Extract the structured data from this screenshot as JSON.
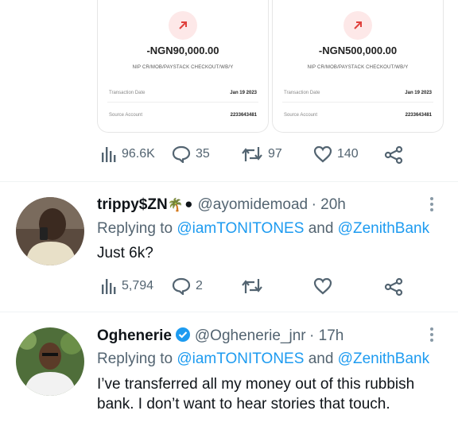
{
  "receipts": [
    {
      "amount": "-NGN90,000.00",
      "ref": "NIP CR/MOB/PAYSTACK CHECKOUT/WB/Y",
      "date_label": "Transaction Date",
      "date_value": "Jan 19 2023",
      "account_label": "Source Account",
      "account_value": "2233643481"
    },
    {
      "amount": "-NGN500,000.00",
      "ref": "NIP CR/MOB/PAYSTACK CHECKOUT/WB/Y",
      "date_label": "Transaction Date",
      "date_value": "Jan 19 2023",
      "account_label": "Source Account",
      "account_value": "2233643481"
    }
  ],
  "tweet1_actions": {
    "views": "96.6K",
    "replies": "35",
    "retweets": "97",
    "likes": "140"
  },
  "tweet2": {
    "name": "trippy$ZN",
    "emoji": "🌴⚫",
    "handle": "@ayomidemoad",
    "time": "· 20h",
    "replying_prefix": "Replying to",
    "reply_to_1": "@iamTONITONES",
    "reply_and": "and",
    "reply_to_2": "@ZenithBank",
    "text": "Just 6k?",
    "views": "5,794",
    "replies": "2"
  },
  "tweet3": {
    "name": "Oghenerie",
    "handle": "@Oghenerie_jnr",
    "time": "· 17h",
    "replying_prefix": "Replying to",
    "reply_to_1": "@iamTONITONES",
    "reply_and": "and",
    "reply_to_2": "@ZenithBank",
    "text_line1": "I’ve transferred all my money out of this rubbish",
    "text_line2": "bank. I don’t want to hear stories that touch."
  },
  "colors": {
    "accent": "#1d9bf0",
    "muted": "#536471",
    "verified": "#1d9bf0"
  }
}
